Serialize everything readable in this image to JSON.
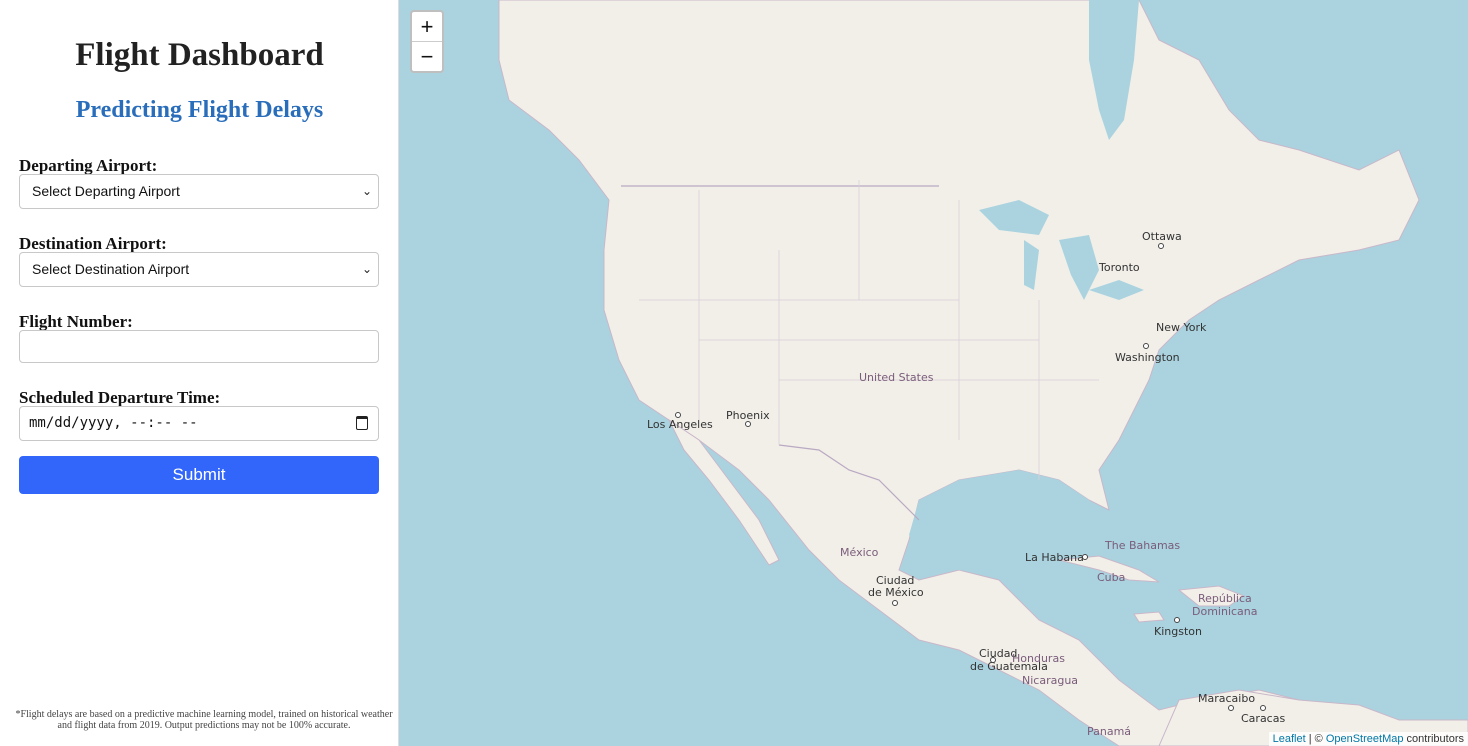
{
  "sidebar": {
    "title": "Flight Dashboard",
    "subtitle": "Predicting Flight Delays",
    "departing_label": "Departing Airport:",
    "departing_selected": "Select Departing Airport",
    "destination_label": "Destination Airport:",
    "destination_selected": "Select Destination Airport",
    "flight_number_label": "Flight Number:",
    "flight_number_value": "",
    "departure_time_label": "Scheduled Departure Time:",
    "departure_time_value": "mm/dd/yyyy, --:-- --",
    "submit_label": "Submit",
    "disclaimer": "*Flight delays are based on a predictive machine learning model, trained on historical weather and flight data from 2019. Output predictions may not be 100% accurate."
  },
  "map": {
    "zoom_in": "+",
    "zoom_out": "−",
    "cities": {
      "ottawa": "Ottawa",
      "toronto": "Toronto",
      "new_york": "New York",
      "washington": "Washington",
      "los_angeles": "Los Angeles",
      "phoenix": "Phoenix",
      "la_habana": "La Habana",
      "kingston": "Kingston",
      "ciudad_de_mexico_1": "Ciudad",
      "ciudad_de_mexico_2": "de México",
      "ciudad_de_guatemala_1": "Ciudad",
      "ciudad_de_guatemala_2": "de Guatemala",
      "maracaibo": "Maracaibo",
      "caracas": "Caracas"
    },
    "countries": {
      "united_states": "United States",
      "mexico": "México",
      "bahamas": "The Bahamas",
      "cuba": "Cuba",
      "dominicana_1": "República",
      "dominicana_2": "Dominicana",
      "honduras": "Honduras",
      "nicaragua": "Nicaragua",
      "panama": "Panamá"
    },
    "attribution": {
      "leaflet": "Leaflet",
      "separator": " | © ",
      "osm": "OpenStreetMap",
      "suffix": " contributors"
    },
    "colors": {
      "water": "#aad3df",
      "land": "#f2efe9",
      "accent": "#3266fb"
    }
  }
}
